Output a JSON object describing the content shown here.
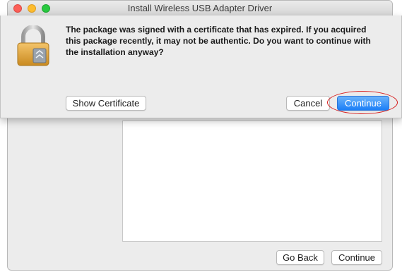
{
  "window": {
    "title": "Install Wireless USB Adapter Driver",
    "buttons": {
      "go_back": "Go Back",
      "continue": "Continue"
    }
  },
  "alert": {
    "icon": "lock-icon",
    "message": "The package was signed with a certificate that has expired. If you acquired this package recently, it may not be authentic. Do you want to continue with the installation anyway?",
    "buttons": {
      "show_certificate": "Show Certificate",
      "cancel": "Cancel",
      "continue": "Continue"
    },
    "highlight_color": "#d61e1e",
    "default_button_color": "#1b7ef7"
  }
}
